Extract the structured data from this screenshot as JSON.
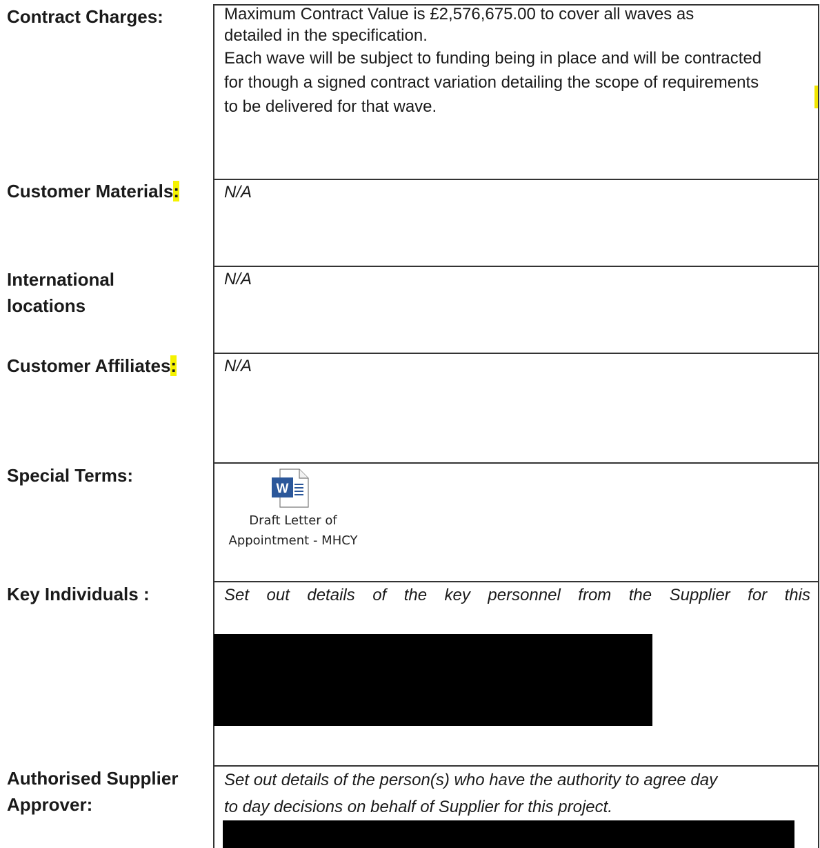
{
  "rows": {
    "contract_charges": {
      "label": "Contract Charges:",
      "lines": [
        "Maximum Contract Value is £2,576,675.00 to cover all waves as",
        "detailed in the specification.",
        "Each wave will be subject to funding being in place and will be contracted",
        "for though a signed contract variation detailing the scope of requirements",
        "to be delivered for that wave."
      ]
    },
    "customer_materials": {
      "label": "Customer Materials",
      "colon": ":",
      "value": "N/A"
    },
    "international_locations": {
      "label_line1": "International",
      "label_line2": "locations",
      "value": "N/A"
    },
    "customer_affiliates": {
      "label": "Customer Affiliates",
      "colon": ":",
      "value": "N/A"
    },
    "special_terms": {
      "label": "Special Terms:",
      "attachment": {
        "icon": "word-document-icon",
        "icon_letter": "W",
        "name_line1": "Draft Letter of",
        "name_line2": "Appointment - MHCY"
      }
    },
    "key_individuals": {
      "label": "Key Individuals :",
      "text": "Set out details of the key personnel from the Supplier for this"
    },
    "authorised_supplier_approver": {
      "label_line1": "Authorised Supplier",
      "label_line2": "Approver:",
      "text_line1": "Set out details of the person(s) who have the authority to agree day",
      "text_line2": "to day decisions on behalf of Supplier for this project."
    }
  },
  "colors": {
    "highlight": "#f5f200",
    "redaction": "#000000",
    "word_blue": "#2b579a"
  }
}
